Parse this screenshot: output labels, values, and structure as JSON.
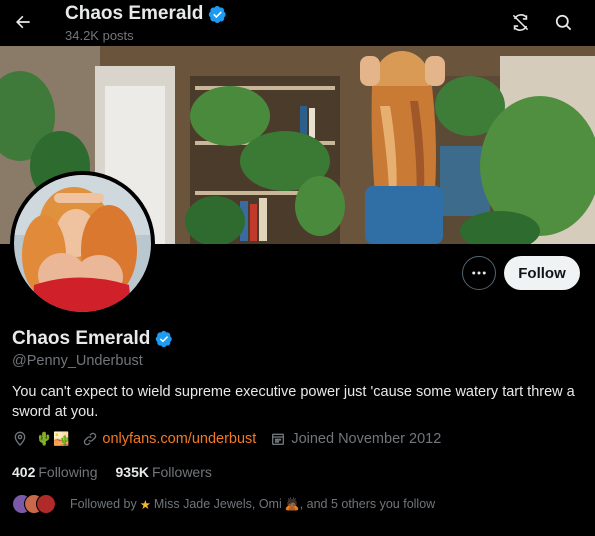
{
  "header": {
    "title": "Chaos Emerald",
    "posts_count": "34.2K posts"
  },
  "profile": {
    "name": "Chaos Emerald",
    "handle": "@Penny_Underbust",
    "bio": "You can't expect to wield supreme executive power just 'cause some watery tart threw a sword at you.",
    "location_emoji": "🌵🏜️",
    "link": "onlyfans.com/underbust",
    "joined": "Joined November 2012",
    "following_count": "402",
    "following_label": "Following",
    "followers_count": "935K",
    "followers_label": "Followers",
    "followed_by_prefix": "Followed by",
    "followed_by_name1": "Miss Jade Jewels, Omi",
    "followed_by_suffix": ", and 5 others you follow",
    "follow_button": "Follow"
  },
  "icons": {
    "back": "back-arrow-icon",
    "refresh": "refresh-icon",
    "search": "search-icon",
    "verified": "verified-badge-icon",
    "more": "more-icon",
    "location": "location-icon",
    "link": "link-icon",
    "calendar": "calendar-icon"
  },
  "colors": {
    "background": "#000000",
    "verified": "#1d9bf0",
    "link": "#f4791f",
    "secondary_text": "#71767b",
    "follow_button_bg": "#eff3f4"
  }
}
